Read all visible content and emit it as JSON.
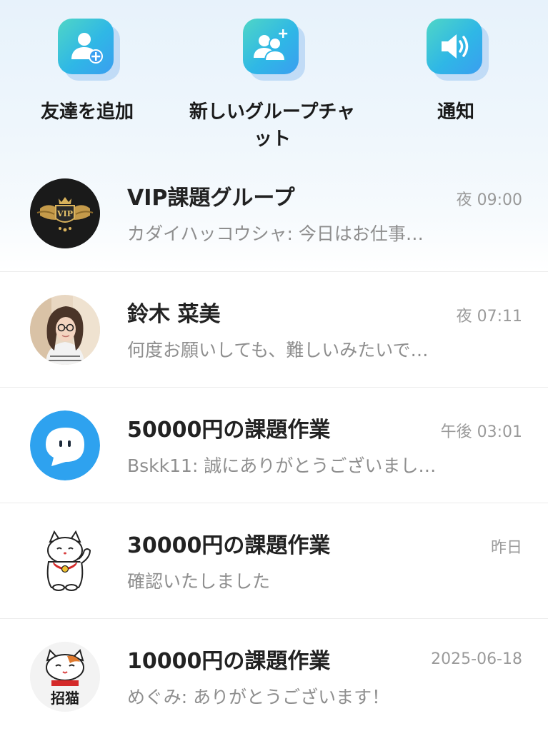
{
  "actions": [
    {
      "label": "友達を追加",
      "icon": "add-user-icon"
    },
    {
      "label": "新しいグループチャット",
      "icon": "group-add-icon"
    },
    {
      "label": "通知",
      "icon": "speaker-icon"
    }
  ],
  "chats": [
    {
      "name": "VIP課題グループ",
      "time": "夜 09:00",
      "preview": "カダイハッコウシャ: 今日はお仕事…",
      "avatar": "vip-badge-icon"
    },
    {
      "name": "鈴木 菜美",
      "time": "夜 07:11",
      "preview": "何度お願いしても、難しいみたいで…",
      "avatar": "woman-photo"
    },
    {
      "name": "50000円の課題作業",
      "time": "午後 03:01",
      "preview": "Bskk11: 誠にありがとうございまし…",
      "avatar": "chat-bubble-icon"
    },
    {
      "name": "30000円の課題作業",
      "time": "昨日",
      "preview": "確認いたしました",
      "avatar": "lucky-cat-icon"
    },
    {
      "name": "10000円の課題作業",
      "time": "2025-06-18",
      "preview": "めぐみ: ありがとうございます！",
      "avatar": "lucky-cat-sign-icon"
    }
  ],
  "avatar_text": {
    "vip": "VIP",
    "cat_sign": "招猫"
  },
  "colors": {
    "tile_gradient_start": "#4fd6c6",
    "tile_gradient_end": "#3a9ef0",
    "name": "#222222",
    "secondary": "#8e8e8e",
    "divider": "#ececec"
  }
}
